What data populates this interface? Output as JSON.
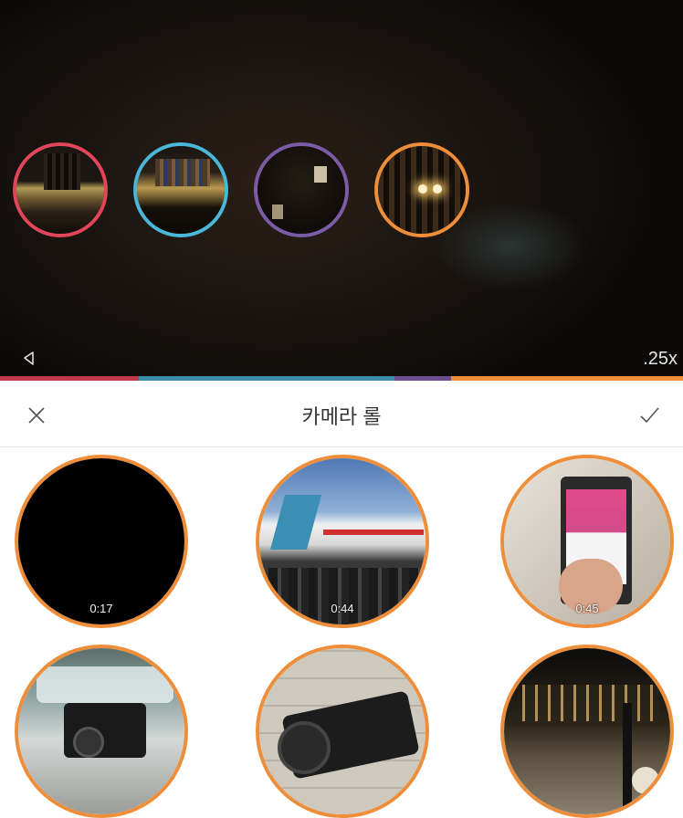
{
  "preview": {
    "speed_label": ".25x",
    "mute_icon": "speaker-muted-icon",
    "clips": [
      {
        "name": "clip-1",
        "ring_color": "#e0455a"
      },
      {
        "name": "clip-2",
        "ring_color": "#4ab7d8"
      },
      {
        "name": "clip-3",
        "ring_color": "#7b5aa6"
      },
      {
        "name": "clip-4",
        "ring_color": "#ee8e3a"
      }
    ],
    "timeline_colors": [
      "#c0394b",
      "#3a8fa8",
      "#6d4e92",
      "#ee8e3a"
    ]
  },
  "header": {
    "title": "카메라 롤",
    "close_icon": "close-icon",
    "confirm_icon": "check-icon"
  },
  "gallery": {
    "ring_color": "#ee8e3a",
    "items": [
      {
        "duration": "0:17"
      },
      {
        "duration": "0:44"
      },
      {
        "duration": "0:45"
      },
      {
        "duration": ""
      },
      {
        "duration": ""
      },
      {
        "duration": ""
      }
    ]
  }
}
